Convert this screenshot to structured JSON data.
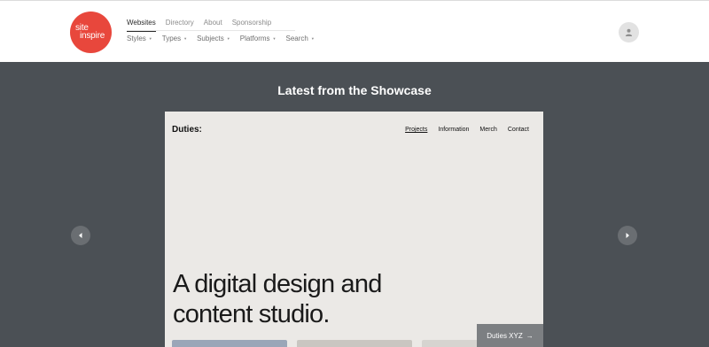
{
  "brand": {
    "logo_line1": "site",
    "logo_line2": "inspire",
    "accent_color": "#e8473c"
  },
  "nav": {
    "primary": [
      {
        "label": "Websites",
        "active": true
      },
      {
        "label": "Directory"
      },
      {
        "label": "About"
      },
      {
        "label": "Sponsorship"
      }
    ],
    "secondary": [
      {
        "label": "Styles"
      },
      {
        "label": "Types"
      },
      {
        "label": "Subjects"
      },
      {
        "label": "Platforms"
      },
      {
        "label": "Search"
      }
    ],
    "user_icon": "user-icon"
  },
  "showcase": {
    "title": "Latest from the Showcase",
    "slide": {
      "brand": "Duties:",
      "nav": [
        {
          "label": "Projects",
          "active": true
        },
        {
          "label": "Information"
        },
        {
          "label": "Merch"
        },
        {
          "label": "Contact"
        }
      ],
      "headline_line1": "A digital design and",
      "headline_line2": "content studio."
    },
    "site_tag": {
      "label": "Duties XYZ",
      "arrow": "→"
    },
    "prev_icon": "chevron-left-icon",
    "next_icon": "chevron-right-icon"
  }
}
